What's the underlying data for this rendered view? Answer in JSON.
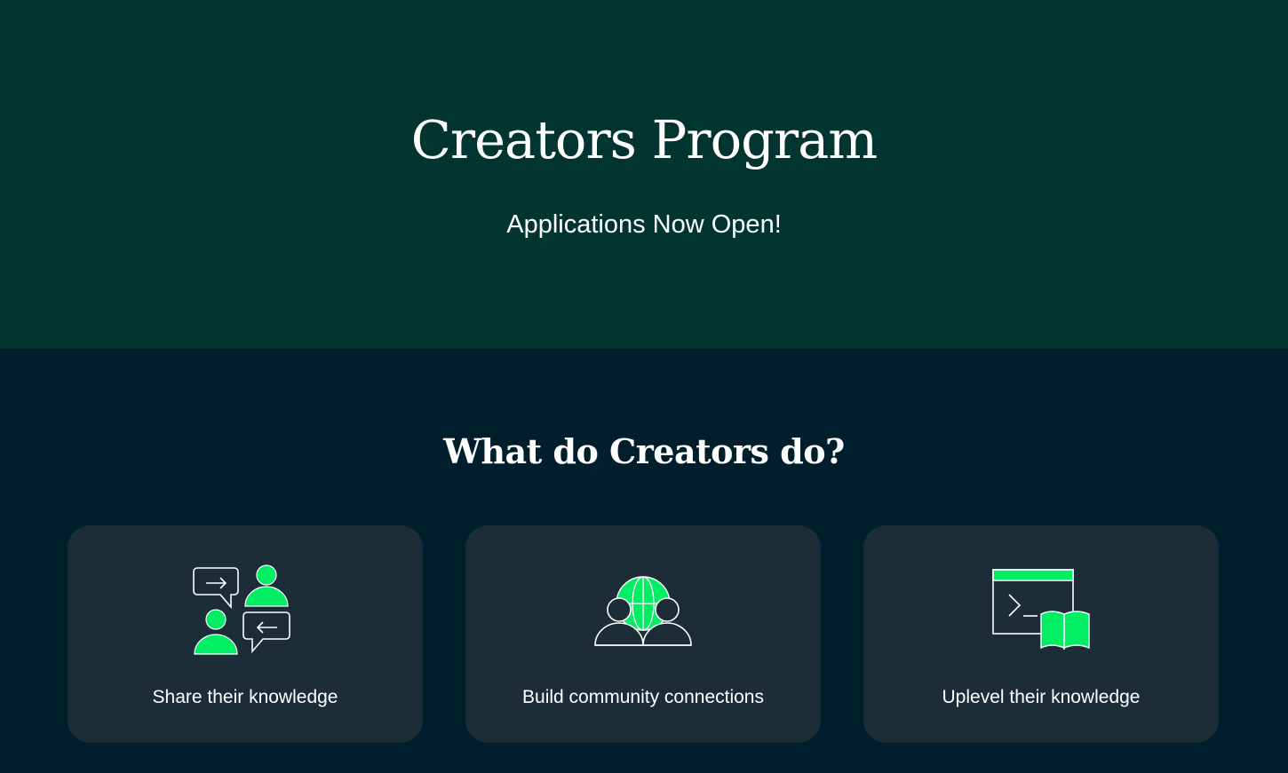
{
  "hero": {
    "title": "Creators Program",
    "subtitle": "Applications Now Open!"
  },
  "section": {
    "title": "What do Creators do?"
  },
  "cards": [
    {
      "label": "Share their knowledge",
      "icon": "people-conversation-icon"
    },
    {
      "label": "Build community connections",
      "icon": "community-globe-icon"
    },
    {
      "label": "Uplevel their knowledge",
      "icon": "terminal-book-icon"
    }
  ],
  "colors": {
    "hero_bg": "#023430",
    "page_bg": "#001e2b",
    "card_bg": "#1c2d38",
    "accent": "#00ed64",
    "text": "#ffffff"
  }
}
